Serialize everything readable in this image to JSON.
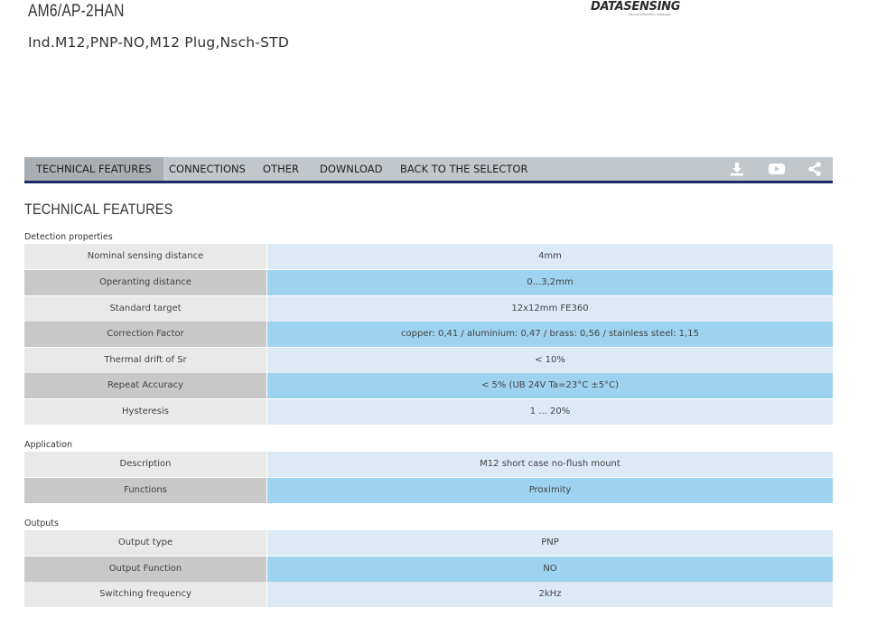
{
  "header": {
    "product_code": "AM6/AP-2HAN",
    "product_description": "Ind.M12,PNP-NO,M12 Plug,Nsch-STD",
    "logo_text": "DATASENSING",
    "logo_tagline": "sensing automation challenges"
  },
  "tabs": [
    {
      "label": "TECHNICAL FEATURES",
      "active": true
    },
    {
      "label": "CONNECTIONS",
      "active": false
    },
    {
      "label": "OTHER",
      "active": false
    },
    {
      "label": "DOWNLOAD",
      "active": false
    },
    {
      "label": "BACK TO THE SELECTOR",
      "active": false
    }
  ],
  "toolbar_icons": [
    "download-icon",
    "youtube-icon",
    "share-icon"
  ],
  "colors": {
    "tabbar_bg": "#c2c7cc",
    "tab_active_bg": "#a9aeb3",
    "tabbar_border": "#1a2a6c",
    "label_light": "#e9e9e9",
    "label_dark": "#c8c8c8",
    "value_light": "#dceaf6",
    "value_dark": "#9dd3ef"
  },
  "section_title": "TECHNICAL FEATURES",
  "groups": [
    {
      "title": "Detection properties",
      "rows": [
        {
          "label": "Nominal sensing distance",
          "value": "4mm"
        },
        {
          "label": "Operanting distance",
          "value": "0...3,2mm"
        },
        {
          "label": "Standard target",
          "value": "12x12mm FE360"
        },
        {
          "label": "Correction Factor",
          "value": "copper: 0,41 / aluminium: 0,47 / brass: 0,56 / stainless steel: 1,15"
        },
        {
          "label": "Thermal drift of Sr",
          "value": "< 10%"
        },
        {
          "label": "Repeat Accuracy",
          "value": "< 5% (UB 24V Ta=23°C ±5°C)"
        },
        {
          "label": "Hysteresis",
          "value": "1 ... 20%"
        }
      ]
    },
    {
      "title": "Application",
      "rows": [
        {
          "label": "Description",
          "value": "M12 short case no-flush mount"
        },
        {
          "label": "Functions",
          "value": "Proximity"
        }
      ]
    },
    {
      "title": "Outputs",
      "rows": [
        {
          "label": "Output type",
          "value": "PNP"
        },
        {
          "label": "Output Function",
          "value": "NO"
        },
        {
          "label": "Switching frequency",
          "value": "2kHz"
        }
      ]
    }
  ]
}
